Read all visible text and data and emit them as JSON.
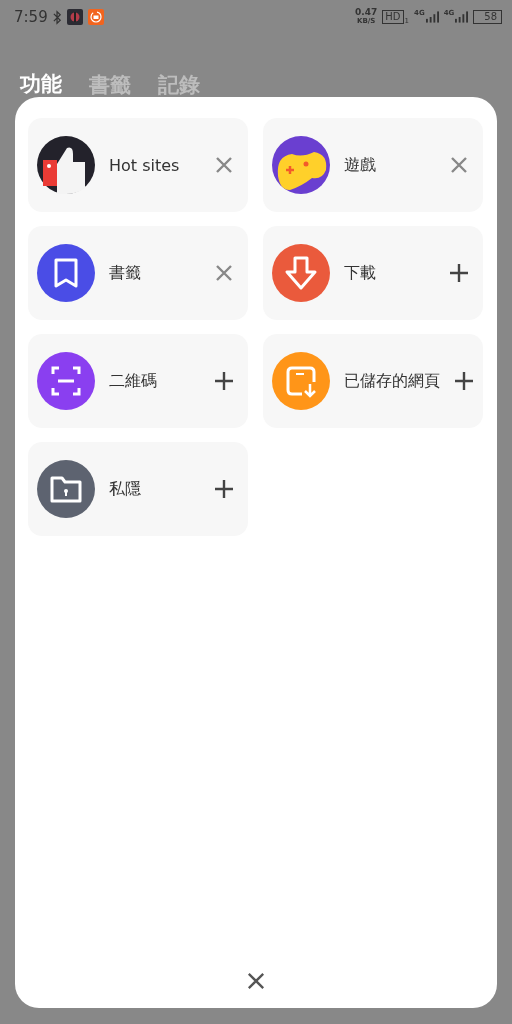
{
  "status_bar": {
    "time": "7:59",
    "speed_value": "0.47",
    "speed_unit": "KB/S",
    "hd": "HD",
    "hd_sub": "1",
    "network_1": "4G",
    "network_2": "4G",
    "battery": "58"
  },
  "tabs": [
    {
      "label": "功能",
      "selected": true
    },
    {
      "label": "書籤",
      "selected": false
    },
    {
      "label": "記錄",
      "selected": false
    }
  ],
  "items": [
    {
      "label": "Hot sites",
      "added": true,
      "color": "#23222b"
    },
    {
      "label": "遊戲",
      "added": true,
      "color": "#6a3fd0"
    },
    {
      "label": "書籤",
      "added": true,
      "color": "#4a4de6"
    },
    {
      "label": "下載",
      "added": false,
      "color": "#ea5a3c"
    },
    {
      "label": "二維碼",
      "added": false,
      "color": "#8a3ff0"
    },
    {
      "label": "已儲存的網頁",
      "added": false,
      "color": "#ff9518"
    },
    {
      "label": "私隱",
      "added": false,
      "color": "#5d6370"
    }
  ]
}
